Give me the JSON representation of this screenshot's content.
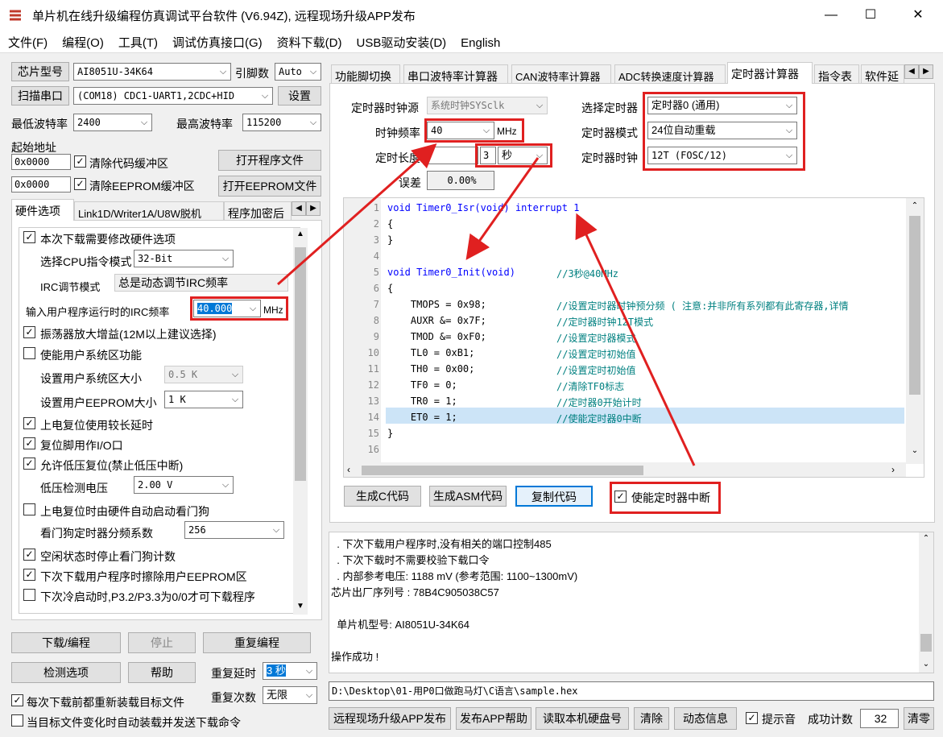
{
  "window": {
    "title": "单片机在线升级编程仿真调试平台软件 (V6.94Z), 远程现场升级APP发布",
    "min": "—",
    "max": "☐",
    "close": "✕"
  },
  "menu": [
    "文件(F)",
    "编程(O)",
    "工具(T)",
    "调试仿真接口(G)",
    "资料下载(D)",
    "USB驱动安装(D)",
    "English"
  ],
  "left": {
    "chip_btn": "芯片型号",
    "chip_value": "AI8051U-34K64",
    "pin_label": "引脚数",
    "pin_value": "Auto",
    "scan_btn": "扫描串口",
    "port_value": "(COM18) CDC1-UART1,2CDC+HID",
    "set_btn": "设置",
    "min_baud_label": "最低波特率",
    "min_baud": "2400",
    "max_baud_label": "最高波特率",
    "max_baud": "115200",
    "start_addr_label": "起始地址",
    "addr1": "0x0000",
    "clear_code": "清除代码缓冲区",
    "open_prog": "打开程序文件",
    "addr2": "0x0000",
    "clear_eeprom": "清除EEPROM缓冲区",
    "open_eeprom": "打开EEPROM文件",
    "tabs": [
      "硬件选项",
      "Link1D/Writer1A/U8W脱机",
      "程序加密后"
    ],
    "opts": {
      "modify_hw": "本次下载需要修改硬件选项",
      "cpu_mode_label": "选择CPU指令模式",
      "cpu_mode": "32-Bit",
      "irc_mode_label": "IRC调节模式",
      "irc_mode": "总是动态调节IRC频率",
      "irc_freq_label": "输入用户程序运行时的IRC频率",
      "irc_freq": "40.000",
      "irc_unit": "MHz",
      "osc_gain": "振荡器放大增益(12M以上建议选择)",
      "user_sys": "使能用户系统区功能",
      "sys_size_label": "设置用户系统区大小",
      "sys_size": "0.5 K",
      "eeprom_size_label": "设置用户EEPROM大小",
      "eeprom_size": "1   K",
      "power_delay": "上电复位使用较长延时",
      "reset_io": "复位脚用作I/O口",
      "low_v_reset": "允许低压复位(禁止低压中断)",
      "low_v_label": "低压检测电压",
      "low_v": "2.00 V",
      "wdt_auto": "上电复位时由硬件自动启动看门狗",
      "wdt_div_label": "看门狗定时器分频系数",
      "wdt_div": "256",
      "idle_wdt": "空闲状态时停止看门狗计数",
      "erase_eeprom": "下次下载用户程序时擦除用户EEPROM区",
      "cold_boot": "下次冷启动时,P3.2/P3.3为0/0才可下载程序"
    },
    "download": "下载/编程",
    "stop": "停止",
    "reprogram": "重复编程",
    "detect": "检测选项",
    "help": "帮助",
    "repeat_delay_label": "重复延时",
    "repeat_delay": "3 秒",
    "repeat_count_label": "重复次数",
    "repeat_count": "无限",
    "reload_each": "每次下载前都重新装载目标文件",
    "auto_reload": "当目标文件变化时自动装载并发送下载命令"
  },
  "right_tabs": [
    "功能脚切换",
    "串口波特率计算器",
    "CAN波特率计算器",
    "ADC转换速度计算器",
    "定时器计算器",
    "指令表",
    "软件延"
  ],
  "timer": {
    "clk_src_label": "定时器时钟源",
    "clk_src": "系统时钟SYSclk",
    "sel_timer_label": "选择定时器",
    "sel_timer": "定时器0 (通用)",
    "clk_freq_label": "时钟频率",
    "clk_freq": "40",
    "clk_unit": "MHz",
    "mode_label": "定时器模式",
    "mode": "24位自动重载",
    "len_label": "定时长度",
    "len_value": "3",
    "len_unit": "秒",
    "clk_label": "定时器时钟",
    "clk": "12T (FOSC/12)",
    "err_label": "误差",
    "err": "0.00%",
    "gen_c": "生成C代码",
    "gen_asm": "生成ASM代码",
    "copy": "复制代码",
    "enable_int": "使能定时器中断"
  },
  "code_lines": [
    {
      "n": "1",
      "t": "void Timer0_Isr(void) interrupt 1"
    },
    {
      "n": "2",
      "t": "{"
    },
    {
      "n": "3",
      "t": "}"
    },
    {
      "n": "4",
      "t": ""
    },
    {
      "n": "5",
      "t": "void Timer0_Init(void)",
      "c": "//3秒@40MHz"
    },
    {
      "n": "6",
      "t": "{"
    },
    {
      "n": "7",
      "t": "    TMOPS = 0x98;",
      "c": "//设置定时器时钟预分频 ( 注意:并非所有系列都有此寄存器,详情"
    },
    {
      "n": "8",
      "t": "    AUXR &= 0x7F;",
      "c": "//定时器时钟12T模式"
    },
    {
      "n": "9",
      "t": "    TMOD &= 0xF0;",
      "c": "//设置定时器模式"
    },
    {
      "n": "10",
      "t": "    TL0 = 0xB1;",
      "c": "//设置定时初始值"
    },
    {
      "n": "11",
      "t": "    TH0 = 0x00;",
      "c": "//设置定时初始值"
    },
    {
      "n": "12",
      "t": "    TF0 = 0;",
      "c": "//清除TF0标志"
    },
    {
      "n": "13",
      "t": "    TR0 = 1;",
      "c": "//定时器0开始计时"
    },
    {
      "n": "14",
      "t": "    ET0 = 1;",
      "c": "//使能定时器0中断"
    },
    {
      "n": "15",
      "t": "}"
    },
    {
      "n": "16",
      "t": ""
    }
  ],
  "log": [
    "  . 下次下载用户程序时,没有相关的端口控制485",
    "  . 下次下载时不需要校验下载口令",
    "  . 内部参考电压: 1188 mV (参考范围: 1100~1300mV)",
    "芯片出厂序列号 : 78B4C905038C57",
    "",
    "  单片机型号: AI8051U-34K64",
    "",
    "操作成功 !"
  ],
  "file_path": "D:\\Desktop\\01-用P0口做跑马灯\\C语言\\sample.hex",
  "bottom": {
    "remote": "远程现场升级APP发布",
    "pub_help": "发布APP帮助",
    "read_disk": "读取本机硬盘号",
    "clear": "清除",
    "dyn_info": "动态信息",
    "beep": "提示音",
    "success_label": "成功计数",
    "success": "32",
    "clear2": "清零"
  }
}
